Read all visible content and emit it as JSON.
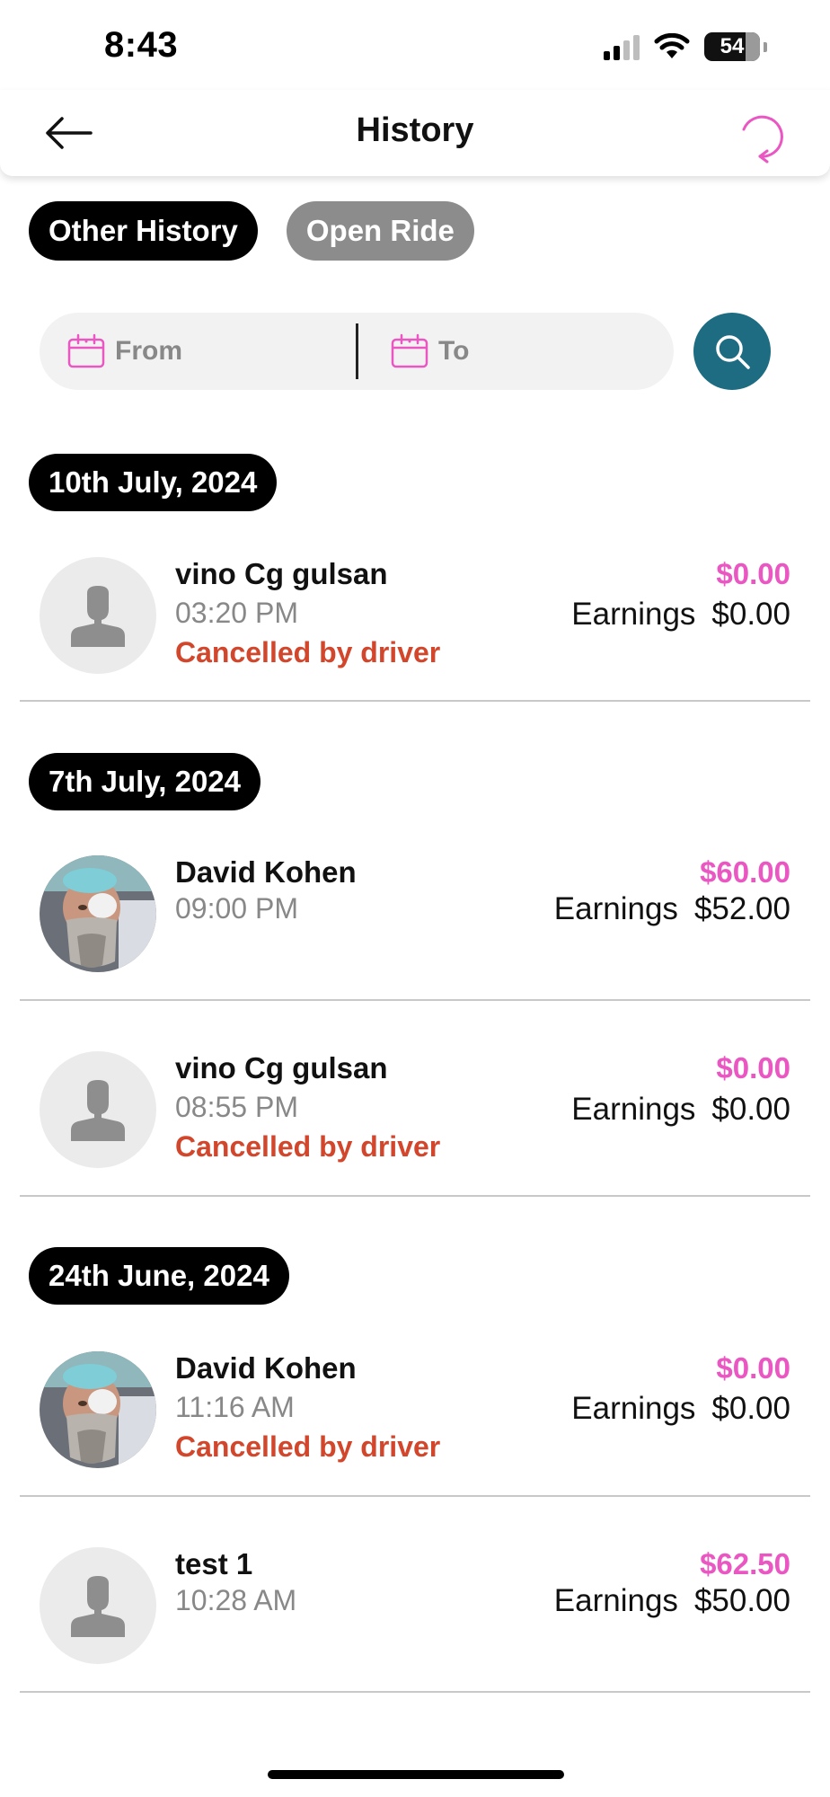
{
  "status_bar": {
    "time": "8:43",
    "battery": "54"
  },
  "header": {
    "title": "History"
  },
  "tabs": [
    {
      "label": "Other History",
      "active": true
    },
    {
      "label": "Open Ride",
      "active": false
    }
  ],
  "filter": {
    "from_placeholder": "From",
    "to_placeholder": "To"
  },
  "groups": [
    {
      "date": "10th July, 2024",
      "rides": [
        {
          "name": "vino Cg gulsan",
          "time": "03:20 PM",
          "status": "Cancelled by driver",
          "fare": "$0.00",
          "earnings_label": "Earnings",
          "earnings": "$0.00",
          "avatar": "placeholder"
        }
      ]
    },
    {
      "date": "7th July, 2024",
      "rides": [
        {
          "name": "David Kohen",
          "time": "09:00 PM",
          "status": "",
          "fare": "$60.00",
          "earnings_label": "Earnings",
          "earnings": "$52.00",
          "avatar": "photo"
        },
        {
          "name": "vino Cg gulsan",
          "time": "08:55 PM",
          "status": "Cancelled by driver",
          "fare": "$0.00",
          "earnings_label": "Earnings",
          "earnings": "$0.00",
          "avatar": "placeholder"
        }
      ]
    },
    {
      "date": "24th June, 2024",
      "rides": [
        {
          "name": "David Kohen",
          "time": "11:16 AM",
          "status": "Cancelled by driver",
          "fare": "$0.00",
          "earnings_label": "Earnings",
          "earnings": "$0.00",
          "avatar": "photo"
        },
        {
          "name": "test 1",
          "time": "10:28 AM",
          "status": "",
          "fare": "$62.50",
          "earnings_label": "Earnings",
          "earnings": "$50.00",
          "avatar": "placeholder"
        }
      ]
    }
  ],
  "colors": {
    "fare": "#ea56c2",
    "cancelled": "#d2462c",
    "search_button": "#1d6c82",
    "calendar_icon": "#ea56c2",
    "refresh_icon": "#ea56c2"
  },
  "icons": {
    "back": "arrow-left-icon",
    "refresh": "refresh-icon",
    "calendar": "calendar-icon",
    "search": "search-icon",
    "avatar_placeholder": "person-silhouette-icon"
  }
}
